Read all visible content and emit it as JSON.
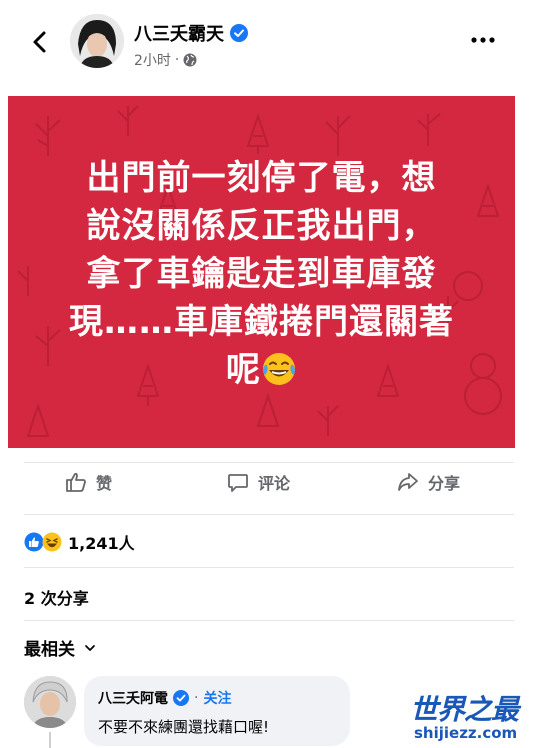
{
  "author": {
    "name": "八三夭霸天",
    "time": "2小时",
    "separator": "·"
  },
  "post": {
    "text_lines": [
      "出門前一刻停了電，想",
      "說沒關係反正我出門，",
      "拿了車鑰匙走到車庫發",
      "現……車庫鐵捲門還關著",
      "呢"
    ],
    "background_color": "#d3283f"
  },
  "actions": {
    "like": "赞",
    "comment": "评论",
    "share": "分享"
  },
  "reactions": {
    "count": "1,241人"
  },
  "shares": {
    "label": "2 次分享"
  },
  "comments_sort": {
    "label": "最相关"
  },
  "comment": {
    "name": "八三夭阿電",
    "separator": "·",
    "follow": "关注",
    "text": "不要不來練團還找藉口喔!"
  },
  "watermark": {
    "title": "世界之最",
    "url": "shijiezz.com"
  },
  "colors": {
    "accent": "#1877f2",
    "secondary_text": "#65676b"
  }
}
